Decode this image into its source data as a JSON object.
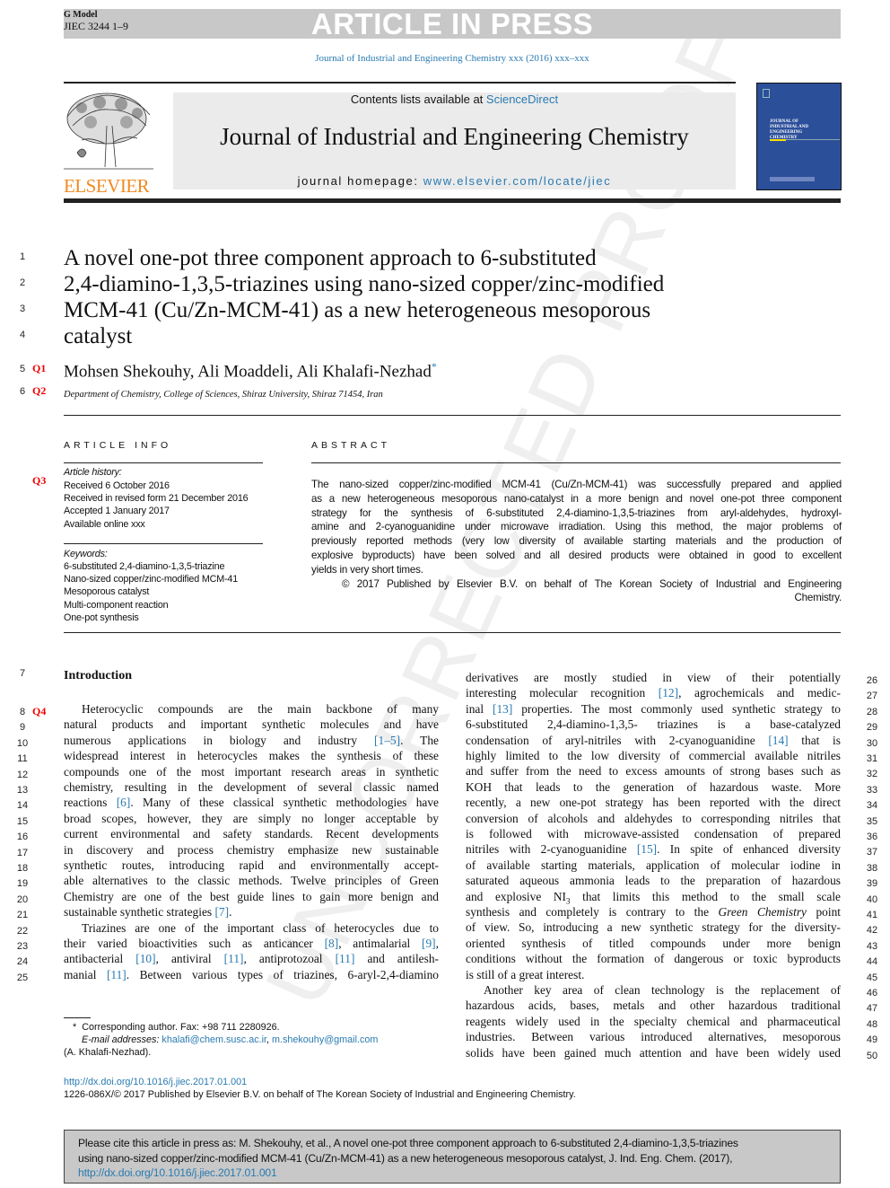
{
  "header": {
    "model": "G Model",
    "code": "JIEC 3244 1–9",
    "banner": "ARTICLE IN PRESS",
    "citation": "Journal of Industrial and Engineering Chemistry xxx (2016) xxx–xxx"
  },
  "masthead": {
    "contents_prefix": "Contents lists available at ",
    "contents_link": "ScienceDirect",
    "journal_title": "Journal of Industrial and Engineering Chemistry",
    "homepage_prefix": "journal homepage: ",
    "homepage_link": "www.elsevier.com/locate/jiec",
    "publisher_logo": "ELSEVIER",
    "cover_title": "Journal of Industrial and Engineering Chemistry"
  },
  "watermark": "UNCORRECTED PROOF",
  "colors": {
    "link": "#2a7ab0",
    "query": "#e00000",
    "elsevier": "#f08a24",
    "banner": "#c8c8c8",
    "cover": "#2c4f9a"
  },
  "title_lines": [
    {
      "n": "1",
      "text": "A novel one-pot three component approach to 6-substituted"
    },
    {
      "n": "2",
      "text": "2,4-diamino-1,3,5-triazines using nano-sized copper/zinc-modified"
    },
    {
      "n": "3",
      "text": "MCM-41 (Cu/Zn-MCM-41) as a new heterogeneous mesoporous"
    },
    {
      "n": "4",
      "text": "catalyst"
    }
  ],
  "authors": {
    "n": "5",
    "q": "Q1",
    "text": "Mohsen Shekouhy, Ali Moaddeli, Ali Khalafi-Nezhad",
    "mark": "*"
  },
  "affiliation": {
    "n": "6",
    "q": "Q2",
    "text": "Department of Chemistry, College of Sciences, Shiraz University, Shiraz 71454, Iran"
  },
  "article_info": {
    "heading": "ARTICLE INFO",
    "q": "Q3",
    "history_label": "Article history:",
    "history": [
      "Received 6 October 2016",
      "Received in revised form 21 December 2016",
      "Accepted 1 January 2017",
      "Available online xxx"
    ],
    "keywords_label": "Keywords:",
    "keywords": [
      "6-substituted 2,4-diamino-1,3,5-triazine",
      "Nano-sized copper/zinc-modified MCM-41",
      "Mesoporous catalyst",
      "Multi-component reaction",
      "One-pot synthesis"
    ]
  },
  "abstract": {
    "heading": "ABSTRACT",
    "lines": [
      "The nano-sized copper/zinc-modified MCM-41 (Cu/Zn-MCM-41) was successfully prepared and applied",
      "as a new heterogeneous mesoporous nano-catalyst in a more benign and novel one-pot three component",
      "strategy for the synthesis of 6-substituted 2,4-diamino-1,3,5-triazines from aryl-aldehydes, hydroxyl-",
      "amine and 2-cyanoguanidine under microwave irradiation. Using this method, the major problems of",
      "previously reported methods (very low diversity of available starting materials and the production of",
      "explosive byproducts) have been solved and all desired products were obtained in good to excellent",
      "yields in very short times.",
      "© 2017 Published by Elsevier B.V. on behalf of The Korean Society of Industrial and Engineering",
      "Chemistry."
    ]
  },
  "intro": {
    "heading": "Introduction",
    "heading_n": "7",
    "left": [
      {
        "n": "8",
        "q": "Q4",
        "ind": true,
        "segs": [
          {
            "t": "Heterocyclic compounds are the main backbone of many"
          }
        ]
      },
      {
        "n": "9",
        "segs": [
          {
            "t": "natural products and important synthetic molecules and have"
          }
        ]
      },
      {
        "n": "10",
        "segs": [
          {
            "t": "numerous applications in biology and industry "
          },
          {
            "t": "[1–5]",
            "k": "ref"
          },
          {
            "t": ". The"
          }
        ]
      },
      {
        "n": "11",
        "segs": [
          {
            "t": "widespread interest in heterocycles makes the synthesis of these"
          }
        ]
      },
      {
        "n": "12",
        "segs": [
          {
            "t": "compounds one of the most important research areas in synthetic"
          }
        ]
      },
      {
        "n": "13",
        "segs": [
          {
            "t": "chemistry, resulting in the development of several classic named"
          }
        ]
      },
      {
        "n": "14",
        "segs": [
          {
            "t": "reactions "
          },
          {
            "t": "[6]",
            "k": "ref"
          },
          {
            "t": ". Many of these classical synthetic methodologies have"
          }
        ]
      },
      {
        "n": "15",
        "segs": [
          {
            "t": "broad scopes, however, they are simply no longer acceptable by"
          }
        ]
      },
      {
        "n": "16",
        "segs": [
          {
            "t": "current environmental and safety standards. Recent developments"
          }
        ]
      },
      {
        "n": "17",
        "segs": [
          {
            "t": "in discovery and process chemistry emphasize new sustainable"
          }
        ]
      },
      {
        "n": "18",
        "segs": [
          {
            "t": "synthetic routes, introducing rapid and environmentally accept-"
          }
        ]
      },
      {
        "n": "19",
        "segs": [
          {
            "t": "able alternatives to the classic methods. Twelve principles of Green"
          }
        ]
      },
      {
        "n": "20",
        "segs": [
          {
            "t": "Chemistry are one of the best guide lines to gain more benign and"
          }
        ]
      },
      {
        "n": "21",
        "last": true,
        "segs": [
          {
            "t": "sustainable synthetic strategies "
          },
          {
            "t": "[7]",
            "k": "ref"
          },
          {
            "t": "."
          }
        ]
      },
      {
        "n": "22",
        "ind": true,
        "segs": [
          {
            "t": "Triazines are one of the important class of heterocycles due to"
          }
        ]
      },
      {
        "n": "23",
        "segs": [
          {
            "t": "their varied bioactivities such as anticancer "
          },
          {
            "t": "[8]",
            "k": "ref"
          },
          {
            "t": ", antimalarial "
          },
          {
            "t": "[9]",
            "k": "ref"
          },
          {
            "t": ","
          }
        ]
      },
      {
        "n": "24",
        "segs": [
          {
            "t": "antibacterial "
          },
          {
            "t": "[10]",
            "k": "ref"
          },
          {
            "t": ", antiviral "
          },
          {
            "t": "[11]",
            "k": "ref"
          },
          {
            "t": ", antiprotozoal "
          },
          {
            "t": "[11]",
            "k": "ref"
          },
          {
            "t": " and antilesh-"
          }
        ]
      },
      {
        "n": "25",
        "segs": [
          {
            "t": "manial "
          },
          {
            "t": "[11]",
            "k": "ref"
          },
          {
            "t": ". Between various types of triazines, 6-aryl-2,4-diamino"
          }
        ]
      }
    ],
    "right": [
      {
        "n": "26",
        "segs": [
          {
            "t": "derivatives are mostly studied in view of their potentially"
          }
        ]
      },
      {
        "n": "27",
        "segs": [
          {
            "t": "interesting molecular recognition "
          },
          {
            "t": "[12]",
            "k": "ref"
          },
          {
            "t": ", agrochemicals and medic-"
          }
        ]
      },
      {
        "n": "28",
        "segs": [
          {
            "t": "inal "
          },
          {
            "t": "[13]",
            "k": "ref"
          },
          {
            "t": " properties. The most commonly used synthetic strategy to"
          }
        ]
      },
      {
        "n": "29",
        "segs": [
          {
            "t": "6-substituted 2,4-diamino-1,3,5- triazines is a base-catalyzed"
          }
        ]
      },
      {
        "n": "30",
        "segs": [
          {
            "t": "condensation of aryl-nitriles with 2-cyanoguanidine "
          },
          {
            "t": "[14]",
            "k": "ref"
          },
          {
            "t": " that is"
          }
        ]
      },
      {
        "n": "31",
        "segs": [
          {
            "t": "highly limited to the low diversity of commercial available nitriles"
          }
        ]
      },
      {
        "n": "32",
        "segs": [
          {
            "t": "and suffer from the need to excess amounts of strong bases such as"
          }
        ]
      },
      {
        "n": "33",
        "segs": [
          {
            "t": "KOH that leads to the generation of hazardous waste. More"
          }
        ]
      },
      {
        "n": "34",
        "segs": [
          {
            "t": "recently, a new one-pot strategy has been reported with the direct"
          }
        ]
      },
      {
        "n": "35",
        "segs": [
          {
            "t": "conversion of alcohols and aldehydes to corresponding nitriles that"
          }
        ]
      },
      {
        "n": "36",
        "segs": [
          {
            "t": "is followed with microwave-assisted condensation of prepared"
          }
        ]
      },
      {
        "n": "37",
        "segs": [
          {
            "t": "nitriles with 2-cyanoguanidine "
          },
          {
            "t": "[15]",
            "k": "ref"
          },
          {
            "t": ". In spite of enhanced diversity"
          }
        ]
      },
      {
        "n": "38",
        "segs": [
          {
            "t": "of available starting materials, application of molecular iodine in"
          }
        ]
      },
      {
        "n": "39",
        "segs": [
          {
            "t": "saturated aqueous ammonia leads to the preparation of hazardous"
          }
        ]
      },
      {
        "n": "40",
        "segs": [
          {
            "t": "and explosive NI"
          },
          {
            "t": "3",
            "k": "sub"
          },
          {
            "t": " that limits this method to the small scale"
          }
        ]
      },
      {
        "n": "41",
        "segs": [
          {
            "t": "synthesis and completely is contrary to the "
          },
          {
            "t": "Green Chemistry",
            "k": "i"
          },
          {
            "t": " point"
          }
        ]
      },
      {
        "n": "42",
        "segs": [
          {
            "t": "of view. So, introducing a new synthetic strategy for the diversity-"
          }
        ]
      },
      {
        "n": "43",
        "segs": [
          {
            "t": "oriented synthesis of titled compounds under more benign"
          }
        ]
      },
      {
        "n": "44",
        "segs": [
          {
            "t": "conditions without the formation of dangerous or toxic byproducts"
          }
        ]
      },
      {
        "n": "45",
        "last": true,
        "segs": [
          {
            "t": "is still of a great interest."
          }
        ]
      },
      {
        "n": "46",
        "ind": true,
        "segs": [
          {
            "t": "Another key area of clean technology is the replacement of"
          }
        ]
      },
      {
        "n": "47",
        "segs": [
          {
            "t": "hazardous acids, bases, metals and other hazardous traditional"
          }
        ]
      },
      {
        "n": "48",
        "segs": [
          {
            "t": "reagents widely used in the specialty chemical and pharmaceutical"
          }
        ]
      },
      {
        "n": "49",
        "segs": [
          {
            "t": "industries. Between various introduced alternatives, mesoporous"
          }
        ]
      },
      {
        "n": "50",
        "segs": [
          {
            "t": "solids have been gained much attention and have been widely used"
          }
        ]
      }
    ]
  },
  "footnote": {
    "mark": "*",
    "corresponding": "Corresponding author. Fax: +98 711 2280926.",
    "email_label": "E-mail addresses: ",
    "email1": "khalafi@chem.susc.ac.ir",
    "sep": ", ",
    "email2": "m.shekouhy@gmail.com",
    "name": "(A. Khalafi-Nezhad)."
  },
  "doi": "http://dx.doi.org/10.1016/j.jiec.2017.01.001",
  "issn": "1226-086X/© 2017 Published by Elsevier B.V. on behalf of The Korean Society of Industrial and Engineering Chemistry.",
  "cite_box": {
    "line1": "Please cite this article in press as: M. Shekouhy, et al., A novel one-pot three component approach to 6-substituted 2,4-diamino-1,3,5-triazines",
    "line2": "using nano-sized copper/zinc-modified MCM-41 (Cu/Zn-MCM-41) as a new heterogeneous mesoporous catalyst, J. Ind. Eng. Chem. (2017),",
    "link": "http://dx.doi.org/10.1016/j.jiec.2017.01.001"
  }
}
